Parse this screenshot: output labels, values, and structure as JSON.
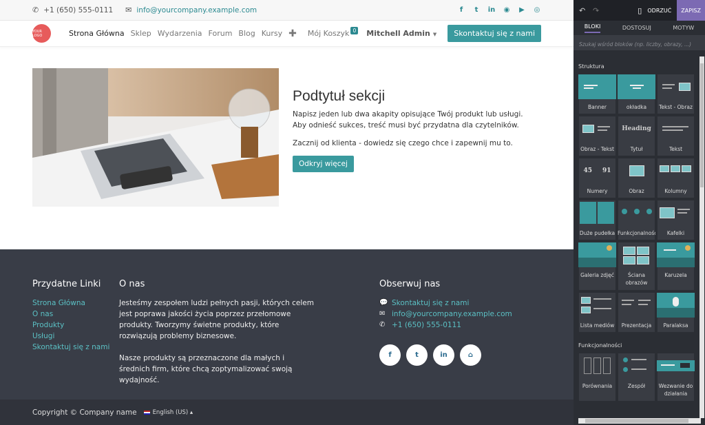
{
  "topbar": {
    "phone": "+1 (650) 555-0111",
    "email": "info@yourcompany.example.com",
    "social_icons": [
      "facebook-icon",
      "twitter-icon",
      "linkedin-icon",
      "github-icon",
      "youtube-icon",
      "instagram-icon"
    ]
  },
  "nav": {
    "logo_text": "YOUR LOGO",
    "items": [
      "Strona Główna",
      "Sklep",
      "Wydarzenia",
      "Forum",
      "Blog",
      "Kursy"
    ],
    "cart_label": "Mój Koszyk",
    "cart_count": "0",
    "user": "Mitchell Admin",
    "contact_button": "Skontaktuj się z nami"
  },
  "hero": {
    "title": "Podtytuł sekcji",
    "paragraph1": "Napisz jeden lub dwa akapity opisujące Twój produkt lub usługi. Aby odnieść sukces, treść musi być przydatna dla czytelników.",
    "paragraph2": "Zacznij od klienta - dowiedz się czego chce i zapewnij mu to.",
    "button": "Odkryj więcej"
  },
  "footer": {
    "links_title": "Przydatne Linki",
    "links": [
      "Strona Główna",
      "O nas",
      "Produkty",
      "Usługi",
      "Skontaktuj się z nami"
    ],
    "about_title": "O nas",
    "about_p1": "Jesteśmy zespołem ludzi pełnych pasji, których celem jest poprawa jakości życia poprzez przełomowe produkty. Tworzymy świetne produkty, które rozwiązują problemy biznesowe.",
    "about_p2": "Nasze produkty są przeznaczone dla małych i średnich firm, które chcą zoptymalizować swoją wydajność.",
    "follow_title": "Obserwuj nas",
    "follow_contact": "Skontaktuj się z nami",
    "follow_email": "info@yourcompany.example.com",
    "follow_phone": "+1 (650) 555-0111",
    "copyright": "Copyright © Company name",
    "language": "English (US)"
  },
  "editor": {
    "discard": "ODRZUĆ",
    "save": "ZAPISZ",
    "tabs": [
      "BLOKI",
      "DOSTOSUJ",
      "MOTYW"
    ],
    "search_placeholder": "Szukaj wśród bloków (np. liczby, obrazy, ...)",
    "section_structure": "Struktura",
    "structure_blocks": [
      "Banner",
      "okładka",
      "Tekst - Obraz",
      "Obraz - Tekst",
      "Tytuł",
      "Tekst",
      "Numery",
      "Obraz",
      "Kolumny",
      "Duże pudełka",
      "Funkcjonalności",
      "Kafelki",
      "Galeria zdjęć",
      "Ściana obrazów",
      "Karuzela",
      "Lista mediów",
      "Prezentacja",
      "Paralaksa"
    ],
    "thumb_heading": "Heading",
    "thumb_numbers": [
      "45",
      "91"
    ],
    "section_features": "Funkcjonalności",
    "feature_blocks": [
      "Porównania",
      "Zespół",
      "Wezwanie do działania"
    ]
  }
}
